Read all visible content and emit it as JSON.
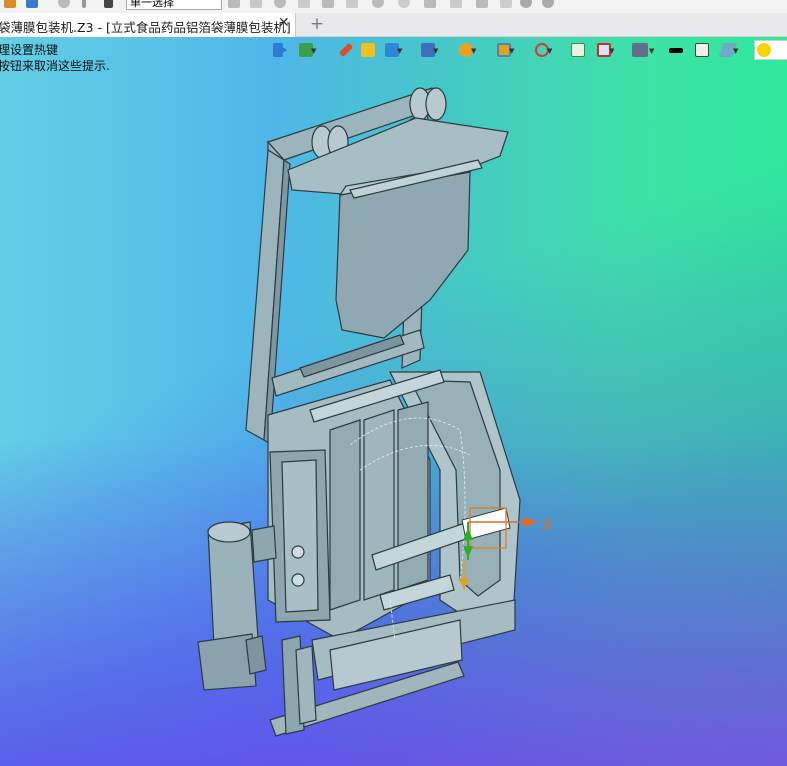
{
  "toolbar": {
    "selection_filter": "单一选择"
  },
  "document_tab": {
    "title": "袋薄膜包装机.Z3 - [立式食品药品铝箔袋薄膜包装机]",
    "close_symbol": "✕",
    "add_symbol": "+"
  },
  "viewport": {
    "hint_line1": "理设置热键",
    "hint_line2": "按钮来取消这些提示.",
    "axis_x_label": "X"
  },
  "view_toolbar": {
    "icons": [
      "exit-icon",
      "display-filter-icon",
      "pick-icon",
      "shaded-icon",
      "box-view-icon",
      "view-orientation-icon",
      "render-mode-icon",
      "section-icon",
      "axis-icon",
      "frame-icon",
      "split-view-icon",
      "background-icon",
      "line-color-icon",
      "square-icon",
      "layer-icon",
      "light-icon"
    ]
  }
}
